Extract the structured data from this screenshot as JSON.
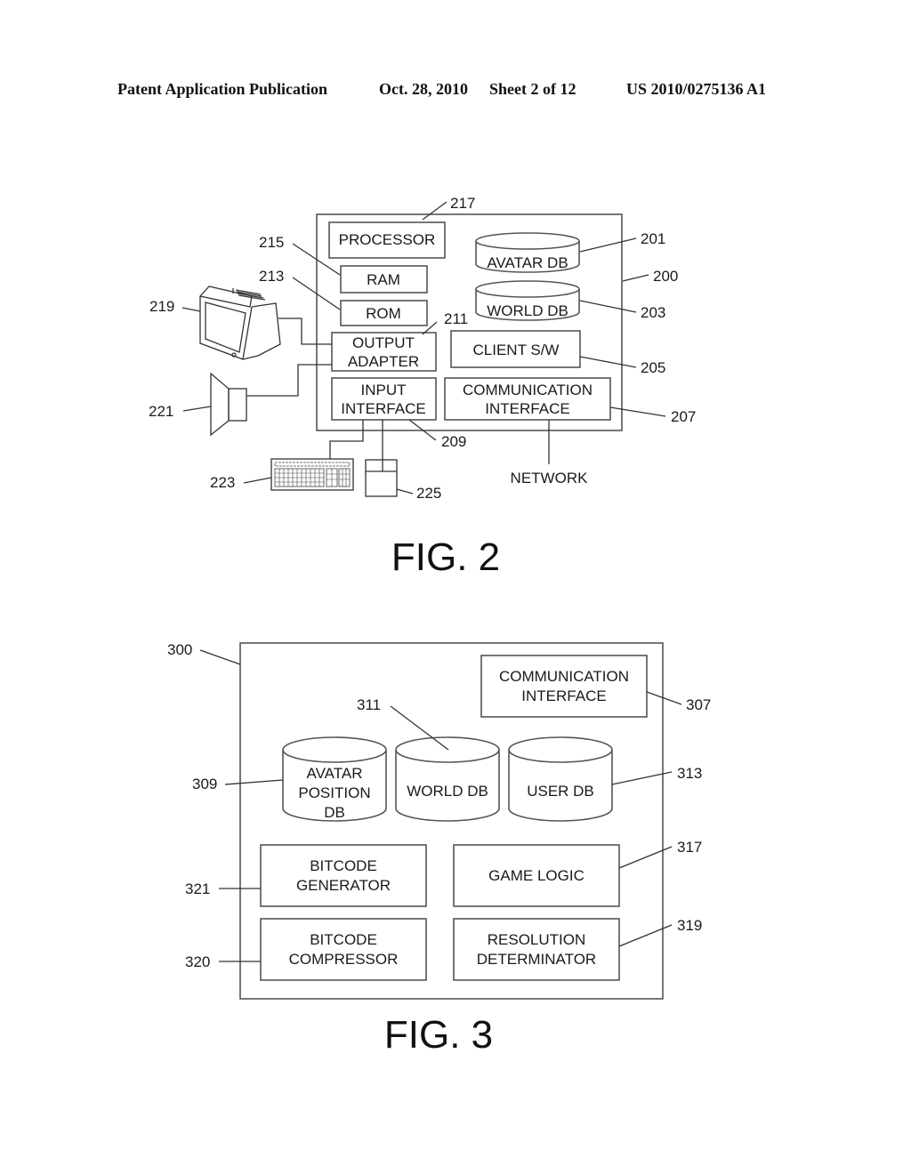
{
  "header": {
    "publication": "Patent Application Publication",
    "date": "Oct. 28, 2010",
    "sheet": "Sheet 2 of 12",
    "number": "US 2010/0275136 A1"
  },
  "fig2": {
    "caption": "FIG. 2",
    "refs": {
      "system": "200",
      "avatar_db": "201",
      "world_db": "203",
      "client_sw": "205",
      "comm_interface": "207",
      "input_interface": "209",
      "output_adapter": "211",
      "rom": "213",
      "ram": "215",
      "processor": "217",
      "monitor": "219",
      "speaker": "221",
      "keyboard": "223",
      "mouse": "225"
    },
    "labels": {
      "processor": "PROCESSOR",
      "ram": "RAM",
      "rom": "ROM",
      "output_adapter": [
        "OUTPUT",
        "ADAPTER"
      ],
      "input_interface": [
        "INPUT",
        "INTERFACE"
      ],
      "avatar_db": "AVATAR DB",
      "world_db": "WORLD DB",
      "client_sw": "CLIENT S/W",
      "comm_interface": [
        "COMMUNICATION",
        "INTERFACE"
      ],
      "network": "NETWORK"
    }
  },
  "fig3": {
    "caption": "FIG. 3",
    "refs": {
      "server": "300",
      "comm_interface": "307",
      "avatar_position_db": "309",
      "world_db": "311",
      "user_db": "313",
      "game_logic": "317",
      "resolution_determinator": "319",
      "bitcode_compressor": "320",
      "bitcode_generator": "321"
    },
    "labels": {
      "comm_interface": [
        "COMMUNICATION",
        "INTERFACE"
      ],
      "avatar_position_db": [
        "AVATAR",
        "POSITION",
        "DB"
      ],
      "world_db": "WORLD DB",
      "user_db": "USER DB",
      "bitcode_generator": [
        "BITCODE",
        "GENERATOR"
      ],
      "game_logic": "GAME LOGIC",
      "bitcode_compressor": [
        "BITCODE",
        "COMPRESSOR"
      ],
      "resolution_determinator": [
        "RESOLUTION",
        "DETERMINATOR"
      ]
    }
  }
}
